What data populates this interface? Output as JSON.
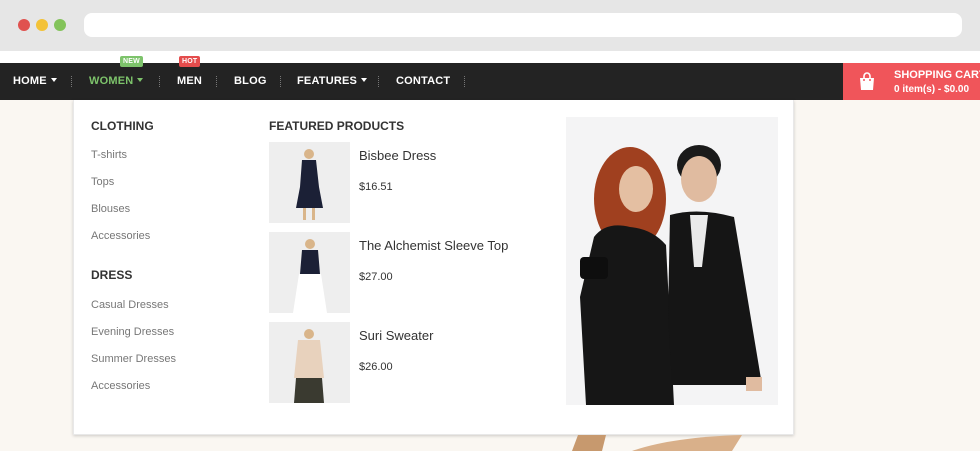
{
  "nav": {
    "items": [
      {
        "label": "HOME",
        "has_caret": true
      },
      {
        "label": "WOMEN",
        "has_caret": true,
        "badge": "NEW"
      },
      {
        "label": "MEN",
        "has_caret": false,
        "badge": "HOT"
      },
      {
        "label": "BLOG",
        "has_caret": false
      },
      {
        "label": "FEATURES",
        "has_caret": true
      },
      {
        "label": "CONTACT",
        "has_caret": false
      }
    ]
  },
  "cart": {
    "title": "SHOPPING CART",
    "summary": "0 item(s) - $0.00",
    "icon": "shopping-bag-icon"
  },
  "mega_menu": {
    "clothing": {
      "title": "CLOTHING",
      "links": [
        "T-shirts",
        "Tops",
        "Blouses",
        "Accessories"
      ]
    },
    "dress": {
      "title": "DRESS",
      "links": [
        "Casual Dresses",
        "Evening Dresses",
        "Summer Dresses",
        "Accessories"
      ]
    },
    "featured": {
      "title": "FEATURED PRODUCTS",
      "products": [
        {
          "name": "Bisbee Dress",
          "price": "$16.51"
        },
        {
          "name": "The Alchemist Sleeve Top",
          "price": "$27.00"
        },
        {
          "name": "Suri Sweater",
          "price": "$26.00"
        }
      ]
    }
  },
  "colors": {
    "navbar": "#232323",
    "active": "#7dc36b",
    "accent": "#f0555a",
    "badge_new": "#7dc36b",
    "badge_hot": "#e44c4c"
  }
}
